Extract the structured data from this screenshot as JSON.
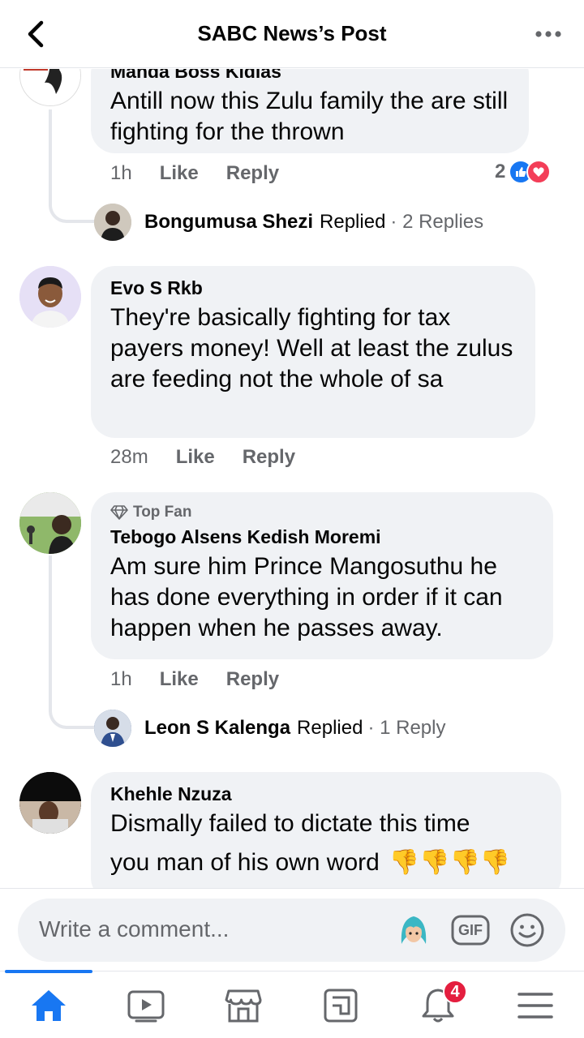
{
  "header": {
    "title": "SABC News’s Post",
    "back_icon": "chevron-left-icon",
    "more_icon": "more-dots-icon"
  },
  "comments": [
    {
      "author": "Manda Boss Kidias",
      "text": "Antill now this Zulu family the are still fighting for the thrown",
      "time": "1h",
      "like": "Like",
      "reply": "Reply",
      "reaction_count": "2",
      "reply_preview": {
        "name": "Bongumusa Shezi",
        "verb": "Replied",
        "count": "· 2 Replies"
      }
    },
    {
      "author": "Evo S Rkb",
      "text": "They're basically fighting for tax payers money! Well at least the zulus are feeding not the whole of sa",
      "time": "28m",
      "like": "Like",
      "reply": "Reply"
    },
    {
      "badge": "Top Fan",
      "author": "Tebogo Alsens Kedish Moremi",
      "text": "Am sure him Prince Mangosuthu he has done everything in order if it can happen when he passes away.",
      "time": "1h",
      "like": "Like",
      "reply": "Reply",
      "reply_preview": {
        "name": "Leon S Kalenga",
        "verb": "Replied",
        "count": "· 1 Reply"
      }
    },
    {
      "author": "Khehle Nzuza",
      "text_line1": "Dismally failed to dictate this time",
      "text_line2": "you man of his own word",
      "emoji": "👎👎👎👎"
    }
  ],
  "composer": {
    "placeholder": "Write a comment...",
    "gif_label": "GIF",
    "icons": [
      "avatar-sticker-icon",
      "gif-icon",
      "smiley-icon"
    ]
  },
  "bottom_nav": {
    "items": [
      "home-icon",
      "video-icon",
      "marketplace-icon",
      "news-icon",
      "notifications-icon",
      "menu-icon"
    ],
    "notifications_badge": "4"
  },
  "colors": {
    "accent": "#1877f2",
    "bubble": "#f0f2f5",
    "secondary_text": "#65676b",
    "badge": "#e41e3f",
    "love": "#f33e58"
  }
}
